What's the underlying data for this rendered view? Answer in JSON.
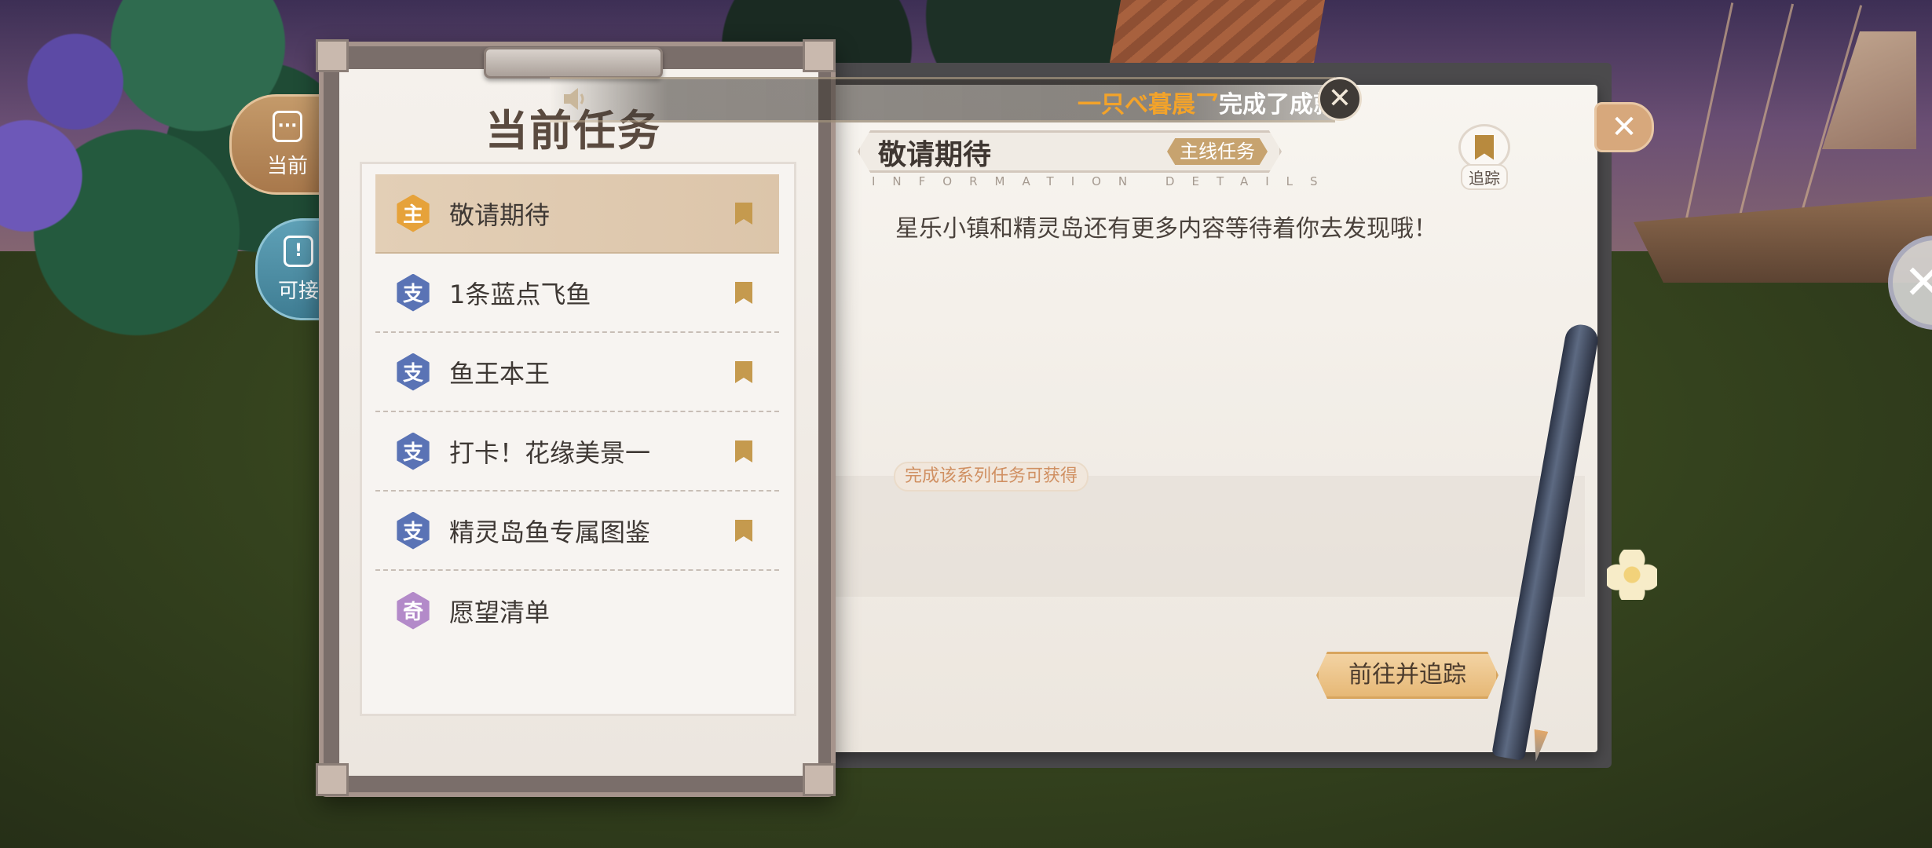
{
  "side_tabs": {
    "current": {
      "label": "当前",
      "icon": "list-clipboard-icon"
    },
    "available": {
      "label": "可接",
      "icon": "exclamation-icon"
    }
  },
  "panel": {
    "title": "当前任务"
  },
  "tasks": [
    {
      "badge": "主",
      "type": "main",
      "name": "敬请期待",
      "active": true
    },
    {
      "badge": "支",
      "type": "side",
      "name": "1条蓝点飞鱼",
      "active": false
    },
    {
      "badge": "支",
      "type": "side",
      "name": "鱼王本王",
      "active": false
    },
    {
      "badge": "支",
      "type": "side",
      "name": "打卡！花缘美景一",
      "active": false
    },
    {
      "badge": "支",
      "type": "side",
      "name": "精灵岛鱼专属图鉴",
      "active": false
    },
    {
      "badge": "奇",
      "type": "wish",
      "name": "愿望清单",
      "active": false
    }
  ],
  "detail": {
    "title": "敬请期待",
    "tag": "主线任务",
    "subheading": "INFORMATION DETAILS",
    "track_label": "追踪",
    "description": "星乐小镇和精灵岛还有更多内容等待着你去发现哦！",
    "reward_label": "完成该系列任务可获得",
    "go_track_button": "前往并追踪"
  },
  "notification": {
    "player": "一只べ暮晨乛",
    "text": "完成了成就"
  },
  "colors": {
    "main_badge": "#e6a23a",
    "side_badge": "#5a73b5",
    "wish_badge": "#b38ac9",
    "accent_gold": "#c59a4e",
    "notif_name": "#f3a32a"
  }
}
